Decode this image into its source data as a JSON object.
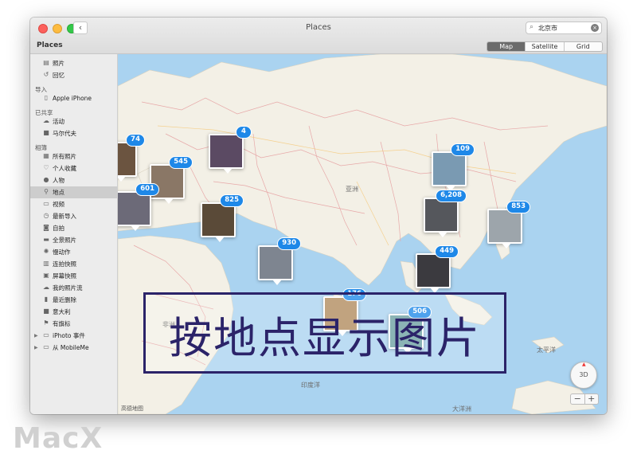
{
  "window": {
    "title": "Places",
    "back_glyph": "‹"
  },
  "search": {
    "value": "北京市",
    "icon": "magnifier-icon",
    "clear_glyph": "×"
  },
  "view_modes": [
    "Map",
    "Satellite",
    "Grid"
  ],
  "active_view": "Map",
  "sidebar": {
    "header": "Places",
    "entries": [
      {
        "kind": "item",
        "label": "照片",
        "icon": "photos-icon",
        "glyph": "▤"
      },
      {
        "kind": "item",
        "label": "回忆",
        "icon": "memories-icon",
        "glyph": "↺"
      },
      {
        "kind": "section",
        "label": "导入"
      },
      {
        "kind": "item",
        "label": "Apple iPhone",
        "icon": "iphone-icon",
        "glyph": "▯"
      },
      {
        "kind": "section",
        "label": "已共享"
      },
      {
        "kind": "item",
        "label": "活动",
        "icon": "cloud-icon",
        "glyph": "☁"
      },
      {
        "kind": "item",
        "label": "马尔代夫",
        "icon": "album-thumb-icon",
        "glyph": "■"
      },
      {
        "kind": "section",
        "label": "相簿"
      },
      {
        "kind": "item",
        "label": "所有照片",
        "icon": "all-photos-icon",
        "glyph": "▦"
      },
      {
        "kind": "item",
        "label": "个人收藏",
        "icon": "heart-icon",
        "glyph": "♡"
      },
      {
        "kind": "item",
        "label": "人物",
        "icon": "person-icon",
        "glyph": "●"
      },
      {
        "kind": "item",
        "label": "地点",
        "icon": "pin-icon",
        "glyph": "⚲",
        "active": true
      },
      {
        "kind": "item",
        "label": "视频",
        "icon": "video-icon",
        "glyph": "▭"
      },
      {
        "kind": "item",
        "label": "最新导入",
        "icon": "clock-icon",
        "glyph": "◷"
      },
      {
        "kind": "item",
        "label": "自拍",
        "icon": "camera-icon",
        "glyph": "◙"
      },
      {
        "kind": "item",
        "label": "全景照片",
        "icon": "panorama-icon",
        "glyph": "▬"
      },
      {
        "kind": "item",
        "label": "慢动作",
        "icon": "slowmo-icon",
        "glyph": "✺"
      },
      {
        "kind": "item",
        "label": "连拍快照",
        "icon": "burst-icon",
        "glyph": "▥"
      },
      {
        "kind": "item",
        "label": "屏幕快照",
        "icon": "screenshot-icon",
        "glyph": "▣"
      },
      {
        "kind": "item",
        "label": "我的照片流",
        "icon": "photostream-icon",
        "glyph": "☁"
      },
      {
        "kind": "item",
        "label": "最近删除",
        "icon": "trash-icon",
        "glyph": "▮"
      },
      {
        "kind": "item",
        "label": "意大利",
        "icon": "album-thumb-icon",
        "glyph": "■"
      },
      {
        "kind": "item",
        "label": "有旗标",
        "icon": "flag-icon",
        "glyph": "⚑"
      },
      {
        "kind": "folder",
        "label": "iPhoto 事件",
        "icon": "folder-icon",
        "glyph": "▭",
        "disclosure": "▶"
      },
      {
        "kind": "folder",
        "label": "从 MobileMe",
        "icon": "folder-icon",
        "glyph": "▭",
        "disclosure": "▶"
      }
    ]
  },
  "map": {
    "labels": {
      "asia": "亚洲",
      "africa": "非洲",
      "pacific": "太平洋",
      "indian_ocean": "印度洋",
      "ocean_south": "大洋洲"
    },
    "legal": "高德地图",
    "compass_label": "3D",
    "compass_needle": "▲",
    "zoom_out": "−",
    "zoom_in": "+",
    "pins": [
      {
        "count": "74",
        "color": "#6b5440"
      },
      {
        "count": "4",
        "color": "#5b4a63"
      },
      {
        "count": "545",
        "color": "#8a7766"
      },
      {
        "count": "601",
        "color": "#6c6a78"
      },
      {
        "count": "825",
        "color": "#5a4a38"
      },
      {
        "count": "930",
        "color": "#7e8590"
      },
      {
        "count": "109",
        "color": "#7a9ab2"
      },
      {
        "count": "6,208",
        "color": "#55575c"
      },
      {
        "count": "853",
        "color": "#9da5ab"
      },
      {
        "count": "449",
        "color": "#3b3a3f"
      },
      {
        "count": "176",
        "color": "#b08a5c"
      },
      {
        "count": "506",
        "color": "#6b9fa1"
      }
    ]
  },
  "overlay_caption": "按地点显示图片",
  "watermark": "MacX",
  "colors": {
    "sea": "#aad3f0",
    "land": "#f3f0e6",
    "border": "#e7a8a8",
    "badge": "#1e88e8",
    "caption": "#2b2369"
  }
}
